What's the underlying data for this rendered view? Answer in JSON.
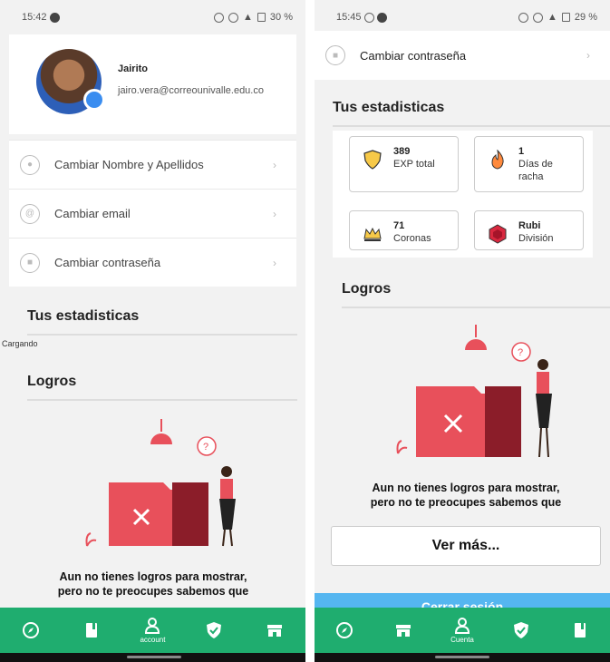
{
  "left": {
    "status": {
      "time": "15:42",
      "battery": "30 %"
    },
    "profile": {
      "name": "Jairito",
      "email": "jairo.vera@correounivalle.edu.co"
    },
    "menu": [
      {
        "label": "Cambiar Nombre y Apellidos",
        "icon": "user-icon"
      },
      {
        "label": "Cambiar email",
        "icon": "at-icon"
      },
      {
        "label": "Cambiar contraseña",
        "icon": "lock-icon"
      }
    ],
    "stats_title": "Tus estadisticas",
    "loading_text": "Cargando",
    "achievements_title": "Logros",
    "empty_message_1": "Aun no tienes logros para mostrar,",
    "empty_message_2": "pero no te preocupes sabemos que",
    "nav": [
      {
        "icon": "compass-icon",
        "label": ""
      },
      {
        "icon": "book-icon",
        "label": ""
      },
      {
        "icon": "account-icon",
        "label": "account"
      },
      {
        "icon": "shield-check-icon",
        "label": ""
      },
      {
        "icon": "store-icon",
        "label": ""
      }
    ]
  },
  "right": {
    "status": {
      "time": "15:45",
      "battery": "29 %"
    },
    "menu_password": "Cambiar contraseña",
    "stats_title": "Tus estadisticas",
    "stats": [
      {
        "value": "389",
        "label": "EXP total",
        "icon": "shield-icon"
      },
      {
        "value": "1",
        "label": "Días de racha",
        "icon": "fire-icon"
      },
      {
        "value": "71",
        "label": "Coronas",
        "icon": "crown-icon"
      },
      {
        "value": "Rubi",
        "label": "División",
        "icon": "ruby-icon"
      }
    ],
    "achievements_title": "Logros",
    "empty_message_1": "Aun no tienes logros para mostrar,",
    "empty_message_2": "pero no te preocupes sabemos que",
    "more_button": "Ver más...",
    "logout_button": "Cerrar sesión",
    "nav": [
      {
        "icon": "compass-icon",
        "label": ""
      },
      {
        "icon": "store-icon",
        "label": ""
      },
      {
        "icon": "account-icon",
        "label": "Cuenta"
      },
      {
        "icon": "shield-check-icon",
        "label": ""
      },
      {
        "icon": "book-icon",
        "label": ""
      }
    ]
  },
  "colors": {
    "nav_green": "#1fad6f",
    "accent_blue": "#55b6f0",
    "folder_red": "#e8505b"
  }
}
